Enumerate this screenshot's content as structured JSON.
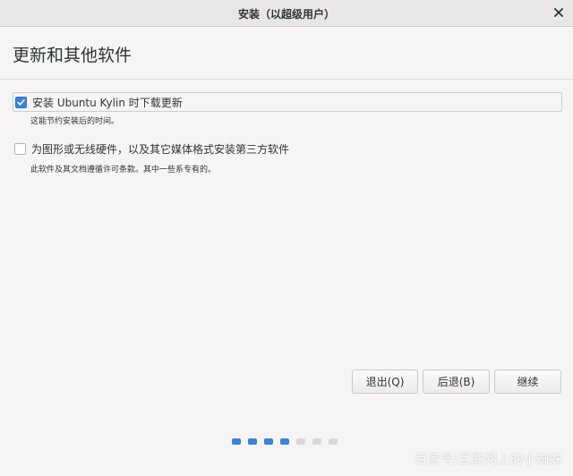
{
  "window": {
    "title": "安装（以超级用户）"
  },
  "page": {
    "title": "更新和其他软件"
  },
  "options": [
    {
      "label": "安装 Ubuntu Kylin 时下载更新",
      "checked": true,
      "description": "这能节约安装后的时间。"
    },
    {
      "label": "为图形或无线硬件，以及其它媒体格式安装第三方软件",
      "checked": false,
      "description": "此软件及其文档遵循许可条款。其中一些系专有的。"
    }
  ],
  "buttons": {
    "quit": "退出(Q)",
    "back": "后退(B)",
    "continue": "继续"
  },
  "progress": {
    "total": 7,
    "completed": 4,
    "active_color": "#3584e4",
    "inactive_color": "#dad8d5"
  },
  "watermark": "百家号/互联网上的小蜘蛛",
  "icons": {
    "close": "close-icon",
    "check": "check-icon"
  }
}
